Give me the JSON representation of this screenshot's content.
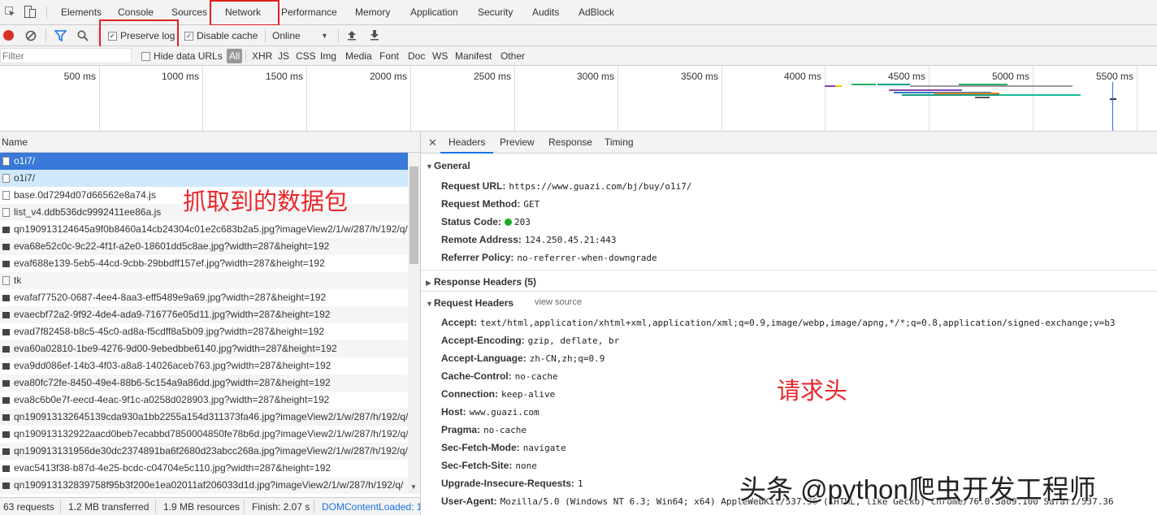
{
  "main_tabs": [
    "Elements",
    "Console",
    "Sources",
    "Network",
    "Performance",
    "Memory",
    "Application",
    "Security",
    "Audits",
    "AdBlock"
  ],
  "toolbar": {
    "preserve_log": "Preserve log",
    "disable_cache": "Disable cache",
    "throttle": "Online"
  },
  "filter": {
    "placeholder": "Filter",
    "hide_data_urls": "Hide data URLs",
    "types": [
      "All",
      "XHR",
      "JS",
      "CSS",
      "Img",
      "Media",
      "Font",
      "Doc",
      "WS",
      "Manifest",
      "Other"
    ]
  },
  "timeline_ticks": [
    "500 ms",
    "1000 ms",
    "1500 ms",
    "2000 ms",
    "2500 ms",
    "3000 ms",
    "3500 ms",
    "4000 ms",
    "4500 ms",
    "5000 ms",
    "5500 ms"
  ],
  "list": {
    "header": "Name",
    "rows": [
      "o1i7/",
      "o1i7/",
      "base.0d7294d07d66562e8a74.js",
      "list_v4.ddb536dc9992411ee86a.js",
      "qn190913124645a9f0b8460a14cb24304c01e2c683b2a5.jpg?imageView2/1/w/287/h/192/q/",
      "eva68e52c0c-9c22-4f1f-a2e0-18601dd5c8ae.jpg?width=287&height=192",
      "evaf688e139-5eb5-44cd-9cbb-29bbdff157ef.jpg?width=287&height=192",
      "tk",
      "evafaf77520-0687-4ee4-8aa3-eff5489e9a69.jpg?width=287&height=192",
      "evaecbf72a2-9f92-4de4-ada9-716776e05d11.jpg?width=287&height=192",
      "evad7f82458-b8c5-45c0-ad8a-f5cdff8a5b09.jpg?width=287&height=192",
      "eva60a02810-1be9-4276-9d00-9ebedbbe6140.jpg?width=287&height=192",
      "eva9dd086ef-14b3-4f03-a8a8-14026aceb763.jpg?width=287&height=192",
      "eva80fc72fe-8450-49e4-88b6-5c154a9a86dd.jpg?width=287&height=192",
      "eva8c6b0e7f-eecd-4eac-9f1c-a0258d028903.jpg?width=287&height=192",
      "qn190913132645139cda930a1bb2255a154d311373fa46.jpg?imageView2/1/w/287/h/192/q/",
      "qn190913132922aacd0beb7ecabbd7850004850fe78b6d.jpg?imageView2/1/w/287/h/192/q/",
      "qn190913131956de30dc2374891ba6f2680d23abcc268a.jpg?imageView2/1/w/287/h/192/q/",
      "evac5413f38-b87d-4e25-bcdc-c04704e5c110.jpg?width=287&height=192",
      "qn190913132839758f95b3f200e1ea02011af206033d1d.jpg?imageView2/1/w/287/h/192/q/"
    ]
  },
  "status": {
    "requests": "63 requests",
    "transferred": "1.2 MB transferred",
    "resources": "1.9 MB resources",
    "finish": "Finish: 2.07 s",
    "dcl": "DOMContentLoaded: 1"
  },
  "detail_tabs": [
    "Headers",
    "Preview",
    "Response",
    "Timing"
  ],
  "general": {
    "title": "General",
    "items": [
      {
        "k": "Request URL:",
        "v": "https://www.guazi.com/bj/buy/o1i7/"
      },
      {
        "k": "Request Method:",
        "v": "GET"
      },
      {
        "k": "Status Code:",
        "v": "203"
      },
      {
        "k": "Remote Address:",
        "v": "124.250.45.21:443"
      },
      {
        "k": "Referrer Policy:",
        "v": "no-referrer-when-downgrade"
      }
    ]
  },
  "response_headers": "Response Headers (5)",
  "request_headers": {
    "title": "Request Headers",
    "view_source": "view source",
    "items": [
      {
        "k": "Accept:",
        "v": "text/html,application/xhtml+xml,application/xml;q=0.9,image/webp,image/apng,*/*;q=0.8,application/signed-exchange;v=b3"
      },
      {
        "k": "Accept-Encoding:",
        "v": "gzip, deflate, br"
      },
      {
        "k": "Accept-Language:",
        "v": "zh-CN,zh;q=0.9"
      },
      {
        "k": "Cache-Control:",
        "v": "no-cache"
      },
      {
        "k": "Connection:",
        "v": "keep-alive"
      },
      {
        "k": "Host:",
        "v": "www.guazi.com"
      },
      {
        "k": "Pragma:",
        "v": "no-cache"
      },
      {
        "k": "Sec-Fetch-Mode:",
        "v": "navigate"
      },
      {
        "k": "Sec-Fetch-Site:",
        "v": "none"
      },
      {
        "k": "Upgrade-Insecure-Requests:",
        "v": "1"
      },
      {
        "k": "User-Agent:",
        "v": "Mozilla/5.0 (Windows NT 6.3; Win64; x64) AppleWebKit/537.36 (KHTML, like Gecko) Chrome/76.0.3809.100 Safari/537.36"
      }
    ]
  },
  "annotations": {
    "packets": "抓取到的数据包",
    "request_headers": "请求头",
    "watermark": "头条 @python爬虫开发工程师"
  },
  "colors": {
    "annotation_red": "#e8262a",
    "selected_row": "#3879d9",
    "record_red": "#d93025",
    "status_green": "#1aab29",
    "link_blue": "#1a73e8"
  }
}
